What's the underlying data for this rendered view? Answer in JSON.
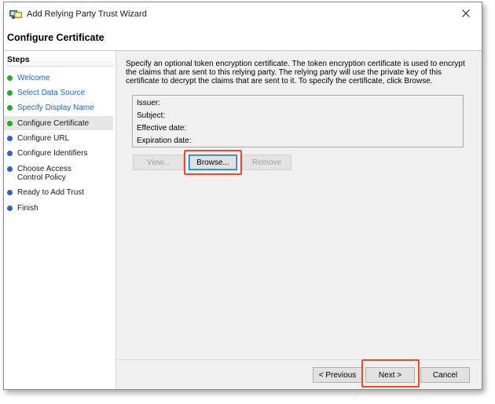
{
  "window": {
    "title": "Add Relying Party Trust Wizard",
    "icon": "relying-party-trust-icon",
    "close_glyph": "✕"
  },
  "page": {
    "heading": "Configure Certificate"
  },
  "sidebar": {
    "title": "Steps",
    "items": [
      {
        "label": "Welcome",
        "state": "completed"
      },
      {
        "label": "Select Data Source",
        "state": "completed"
      },
      {
        "label": "Specify Display Name",
        "state": "completed"
      },
      {
        "label": "Configure Certificate",
        "state": "current"
      },
      {
        "label": "Configure URL",
        "state": "pending"
      },
      {
        "label": "Configure Identifiers",
        "state": "pending"
      },
      {
        "label": "Choose Access Control Policy",
        "state": "pending"
      },
      {
        "label": "Ready to Add Trust",
        "state": "pending"
      },
      {
        "label": "Finish",
        "state": "pending"
      }
    ]
  },
  "main": {
    "description": "Specify an optional token encryption certificate.  The token encryption certificate is used to encrypt the claims that are sent to this relying party.  The relying party will use the private key of this certificate to decrypt the claims that are sent to it.  To specify the certificate, click Browse.",
    "certificate": {
      "issuer_label": "Issuer:",
      "subject_label": "Subject:",
      "effective_label": "Effective date:",
      "expiration_label": "Expiration date:"
    },
    "buttons": {
      "view": "View...",
      "browse": "Browse...",
      "remove": "Remove"
    }
  },
  "footer": {
    "previous": "< Previous",
    "next": "Next >",
    "cancel": "Cancel"
  },
  "colors": {
    "completed_step": "#1a66c9",
    "completed_dot": "#27a827",
    "pending_dot": "#2c63c4",
    "highlight": "#e84a2f",
    "focus": "#0078d7"
  }
}
